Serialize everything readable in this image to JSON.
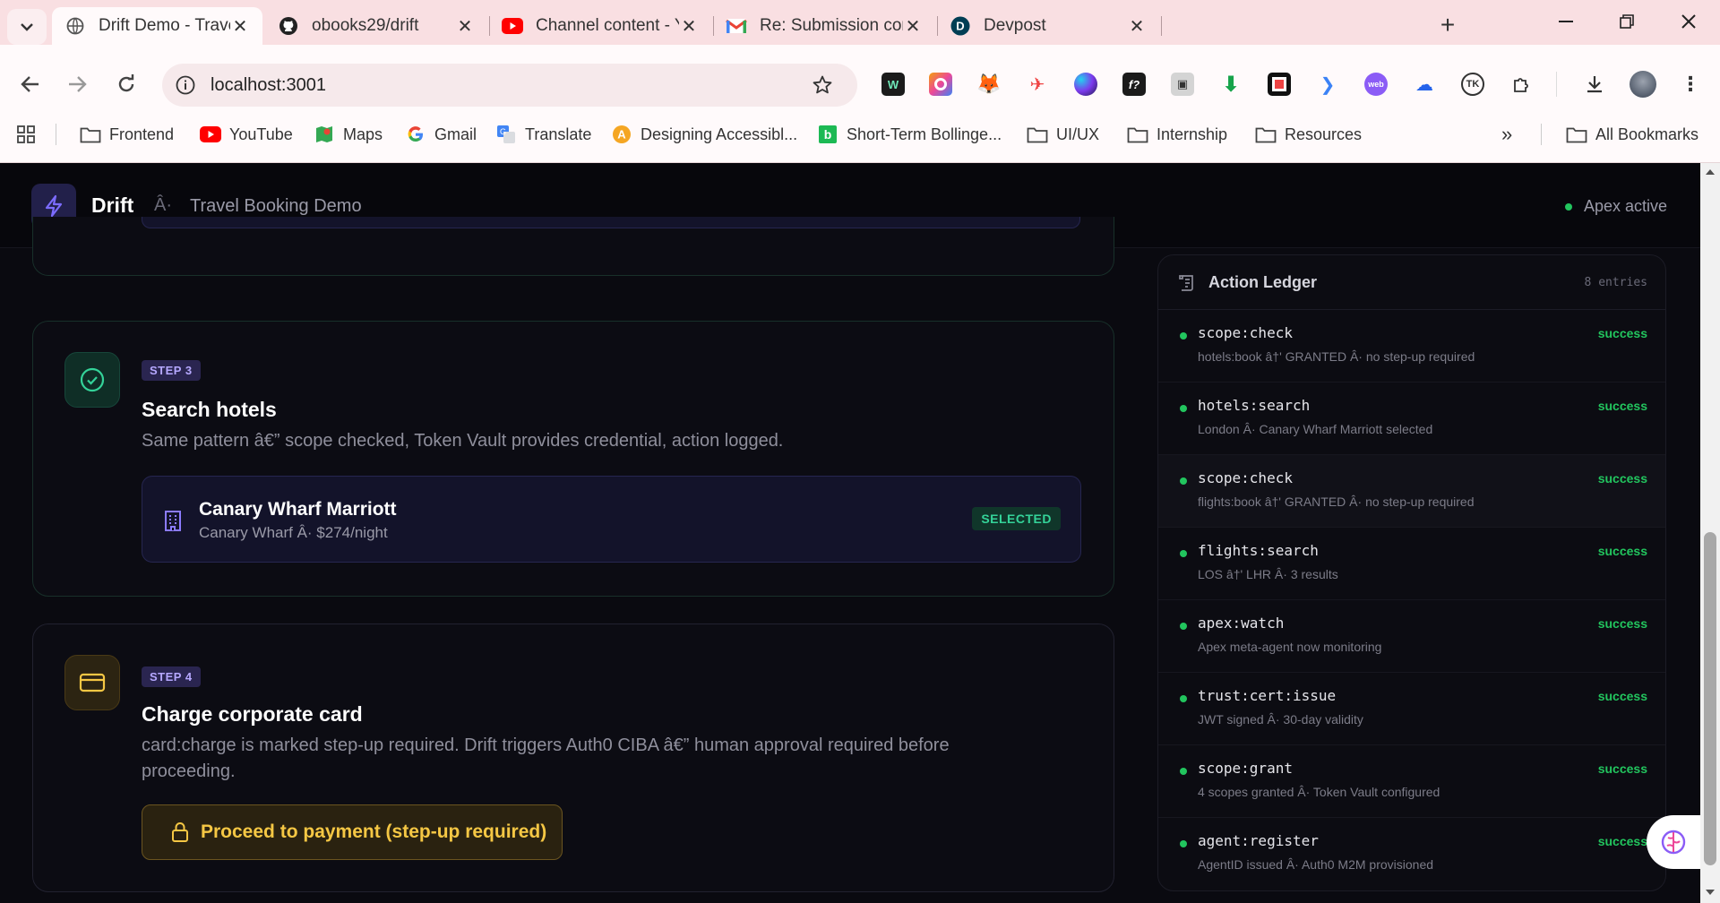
{
  "browser": {
    "tabs": [
      {
        "title": "Drift Demo - Travel Booki",
        "icon": "globe-icon"
      },
      {
        "title": "obooks29/drift",
        "icon": "github-icon"
      },
      {
        "title": "Channel content - YouTu",
        "icon": "youtube-icon"
      },
      {
        "title": "Re: Submission confirmed",
        "icon": "gmail-icon"
      },
      {
        "title": "Devpost",
        "icon": "devpost-icon"
      }
    ],
    "url": "localhost:3001",
    "bookmarks": [
      {
        "label": "Frontend",
        "icon": "folder-icon"
      },
      {
        "label": "YouTube",
        "icon": "youtube-icon"
      },
      {
        "label": "Maps",
        "icon": "maps-icon"
      },
      {
        "label": "Gmail",
        "icon": "google-icon"
      },
      {
        "label": "Translate",
        "icon": "translate-icon"
      },
      {
        "label": "Designing Accessibl...",
        "icon": "a-icon"
      },
      {
        "label": "Short-Term Bollinge...",
        "icon": "b-icon"
      },
      {
        "label": "UI/UX",
        "icon": "folder-icon"
      },
      {
        "label": "Internship",
        "icon": "folder-icon"
      },
      {
        "label": "Resources",
        "icon": "folder-icon"
      }
    ],
    "all_bookmarks": "All Bookmarks",
    "extension_icons": [
      "wakatime-icon",
      "colorzilla-icon",
      "metamask-icon",
      "hermes-icon",
      "edge-icon",
      "function-icon",
      "reader-icon",
      "download-green-icon",
      "qr-icon",
      "bolt-icon",
      "webfigma-icon",
      "cloud-user-icon",
      "tk-icon",
      "puzzle-icon",
      "downloads-icon",
      "profile-avatar"
    ]
  },
  "app": {
    "brand": "Drift",
    "separator": "Â·",
    "subtitle": "Travel Booking Demo",
    "status": "Apex active",
    "accent": "#7c6cff",
    "success_color": "#22c55e",
    "warning_color": "#f5c744"
  },
  "steps": [
    {
      "badge": "STEP 3",
      "title": "Search hotels",
      "desc": "Same pattern â€” scope checked, Token Vault provides credential, action logged.",
      "result_name": "Canary Wharf Marriott",
      "result_detail": "Canary Wharf Â· $274/night",
      "result_badge": "SELECTED"
    },
    {
      "badge": "STEP 4",
      "title": "Charge corporate card",
      "desc_line1": "card:charge is marked step-up required. Drift triggers Auth0 CIBA â€” human approval required before",
      "desc_line2": "proceeding.",
      "button": "Proceed to payment (step-up required)"
    }
  ],
  "ledger": {
    "title": "Action Ledger",
    "count": "8 entries",
    "entries": [
      {
        "action": "scope:check",
        "status": "success",
        "meta": "hotels:book â†' GRANTED Â· no step-up required"
      },
      {
        "action": "hotels:search",
        "status": "success",
        "meta": "London Â· Canary Wharf Marriott selected"
      },
      {
        "action": "scope:check",
        "status": "success",
        "meta": "flights:book â†' GRANTED Â· no step-up required"
      },
      {
        "action": "flights:search",
        "status": "success",
        "meta": "LOS â†' LHR Â· 3 results"
      },
      {
        "action": "apex:watch",
        "status": "success",
        "meta": "Apex meta-agent now monitoring"
      },
      {
        "action": "trust:cert:issue",
        "status": "success",
        "meta": "JWT signed Â· 30-day validity"
      },
      {
        "action": "scope:grant",
        "status": "success",
        "meta": "4 scopes granted Â· Token Vault configured"
      },
      {
        "action": "agent:register",
        "status": "success",
        "meta": "AgentID issued Â· Auth0 M2M provisioned"
      }
    ]
  }
}
